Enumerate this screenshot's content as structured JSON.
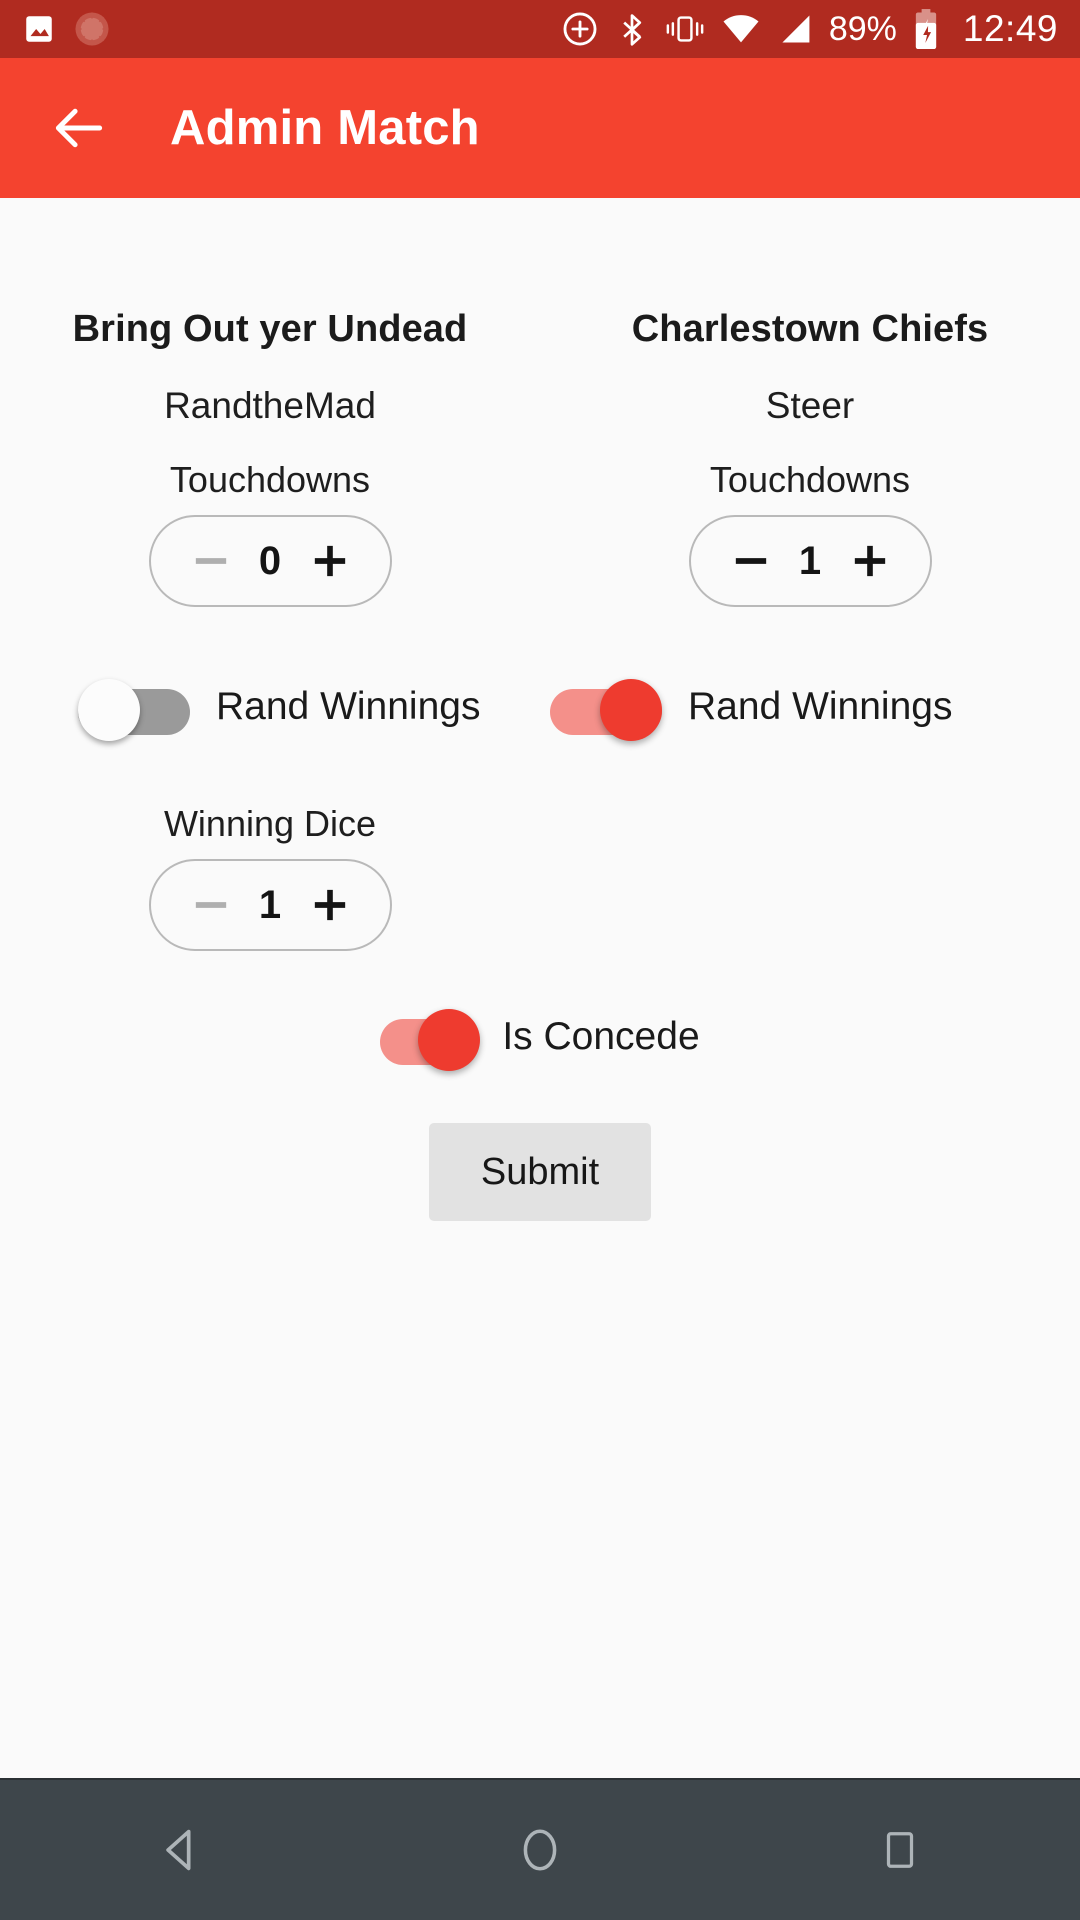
{
  "status_bar": {
    "background": "#B02B20",
    "left_icons": [
      "image-icon",
      "sunburst-icon"
    ],
    "right_icons": [
      "location-add-icon",
      "bluetooth-icon",
      "vibrate-icon",
      "wifi-icon",
      "signal-icon"
    ],
    "battery_percent": "89%",
    "battery_icon": "battery-charging-icon",
    "clock": "12:49"
  },
  "app_bar": {
    "background": "#F4432F",
    "back_icon": "arrow-back-icon",
    "title": "Admin Match"
  },
  "teams": [
    {
      "name": "Bring Out yer Undead",
      "coach": "RandtheMad",
      "touchdowns_label": "Touchdowns",
      "touchdowns_value": "0",
      "minus_enabled": false,
      "plus_enabled": true,
      "rand_winnings_label": "Rand Winnings",
      "rand_winnings_on": false
    },
    {
      "name": "Charlestown Chiefs",
      "coach": "Steer",
      "touchdowns_label": "Touchdowns",
      "touchdowns_value": "1",
      "minus_enabled": true,
      "plus_enabled": true,
      "rand_winnings_label": "Rand Winnings",
      "rand_winnings_on": true
    }
  ],
  "winning_dice": {
    "label": "Winning Dice",
    "value": "1",
    "minus_enabled": false,
    "plus_enabled": true
  },
  "concede": {
    "label": "Is Concede",
    "on": true
  },
  "submit": {
    "label": "Submit"
  },
  "nav_bar": {
    "background": "#3E464B",
    "buttons": [
      "back-nav-icon",
      "home-nav-icon",
      "recents-nav-icon"
    ]
  },
  "colors": {
    "accent": "#F4432F",
    "accent_dark": "#B02B20",
    "switch_on_thumb": "#EE3B2F",
    "switch_on_track": "#F4908A",
    "switch_off_track": "#9A9A9A",
    "page_background": "#FAFAFA",
    "submit_background": "#E2E2E2"
  }
}
